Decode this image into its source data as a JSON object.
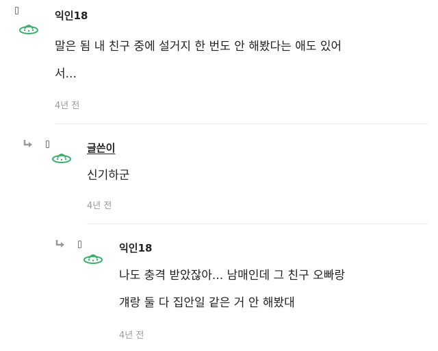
{
  "comments": [
    {
      "author": "익인18",
      "author_is_writer": false,
      "lines": [
        "말은 됨 내 친구 중에 설거지 한 번도 안 해봤다는 애도 있어",
        "서..."
      ],
      "time": "4년 전",
      "avatar_icon": "ufo-icon",
      "indent": 0
    },
    {
      "author": "글쓴이",
      "author_is_writer": true,
      "lines": [
        "신기하군"
      ],
      "time": "4년 전",
      "avatar_icon": "ufo-icon",
      "indent": 1
    },
    {
      "author": "익인18",
      "author_is_writer": false,
      "lines": [
        "나도 충격 받았잖아... 남매인데 그 친구 오빠랑",
        "걔랑 둘 다 집안일 같은 거 안 해봤대"
      ],
      "time": "4년 전",
      "avatar_icon": "ufo-icon",
      "indent": 2
    }
  ],
  "colors": {
    "avatar_green": "#34b36a",
    "time_gray": "#9a9a9a",
    "reply_arrow_gray": "#9a9a9a",
    "divider": "#ececec"
  }
}
